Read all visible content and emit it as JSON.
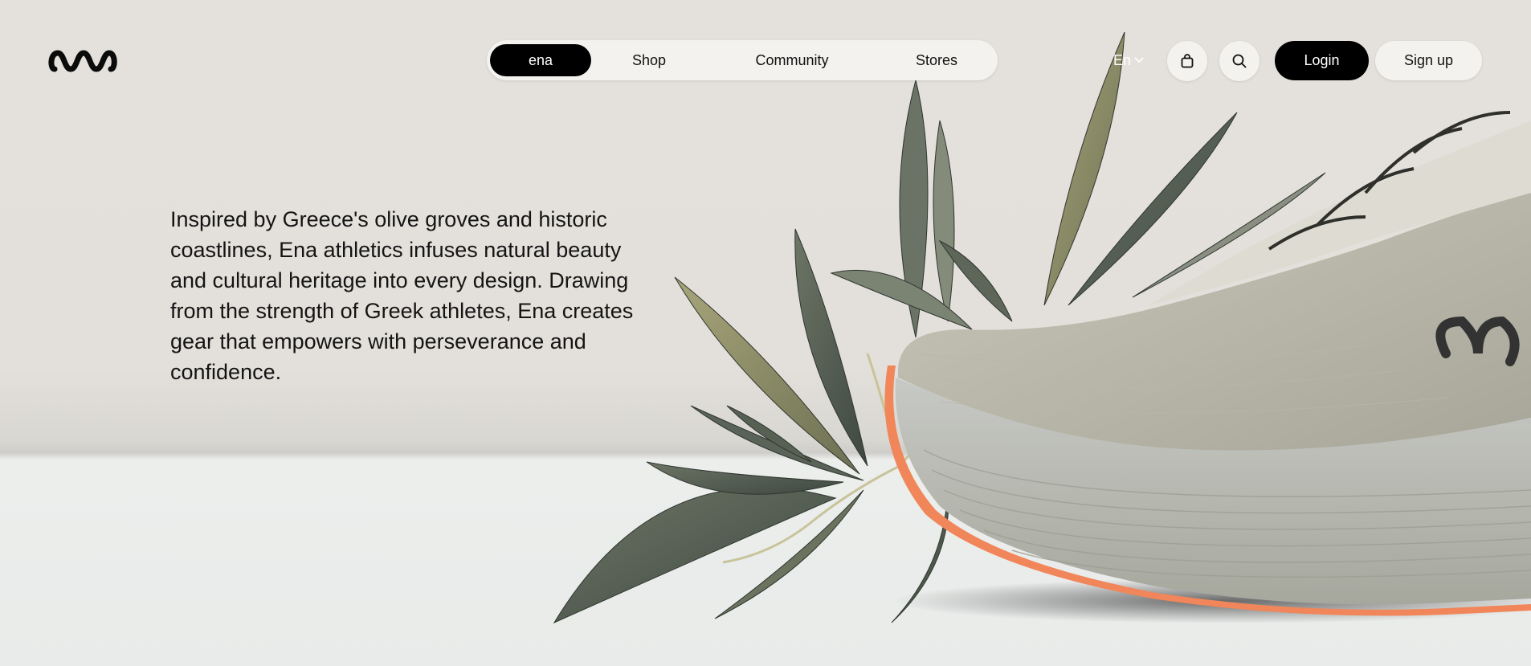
{
  "brand": {
    "logo_icon": "ena-wave-logo"
  },
  "nav": {
    "items": [
      {
        "label": "ena",
        "active": true
      },
      {
        "label": "Shop",
        "active": false
      },
      {
        "label": "Community",
        "active": false
      },
      {
        "label": "Stores",
        "active": false
      }
    ]
  },
  "header": {
    "language": "En",
    "language_icon": "chevron-down-icon",
    "cart_icon": "shopping-bag-icon",
    "search_icon": "search-icon",
    "login_label": "Login",
    "signup_label": "Sign up"
  },
  "hero": {
    "text": "Inspired by Greece's olive groves and historic coastlines, Ena athletics infuses natural beauty and cultural heritage into every design. Drawing from the strength of Greek athletes, Ena creates gear that empowers with perseverance and confidence.",
    "image_subject": "running-shoe-with-olive-leaves"
  },
  "colors": {
    "background": "#e4e1dc",
    "floor": "#ebedeb",
    "primary_button": "#000000",
    "pill": "#f3f2ef",
    "sole_accent": "#f0865a",
    "leaf_dark": "#4f5a4e",
    "leaf_light": "#8e8f64"
  }
}
